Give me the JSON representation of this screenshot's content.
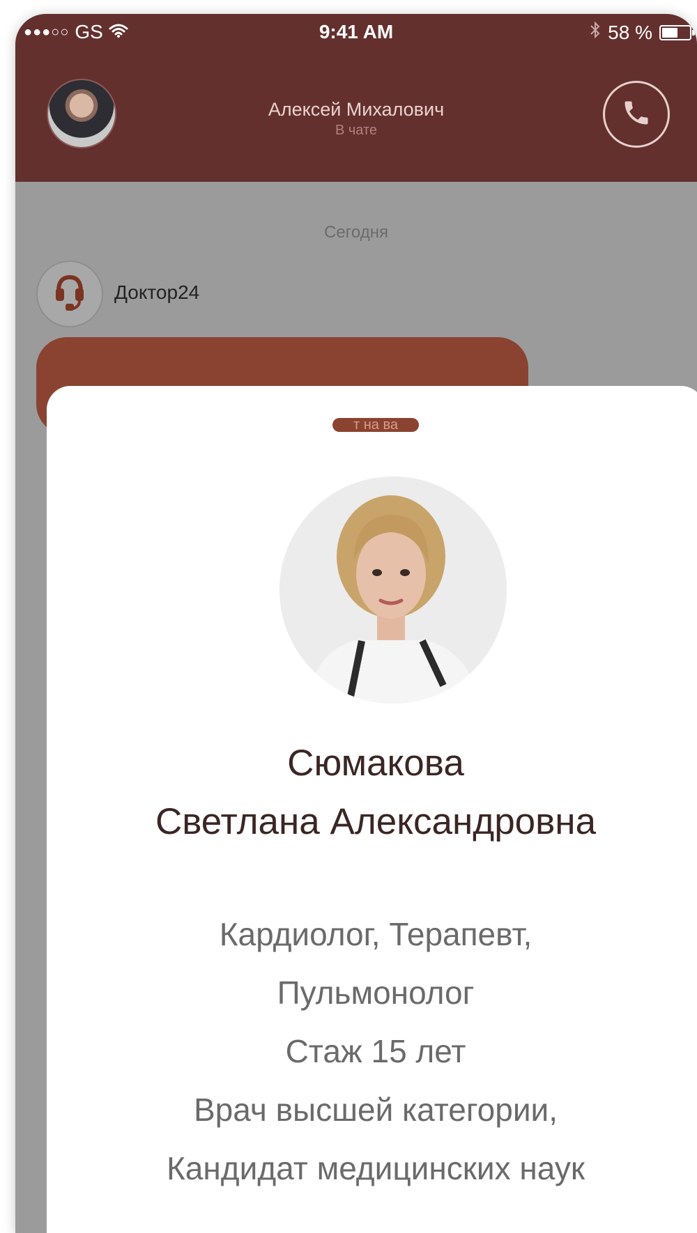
{
  "status_bar": {
    "signal": "●●●○○",
    "carrier": "GS",
    "time": "9:41 AM",
    "battery_text": "58 %",
    "battery_level": 0.58
  },
  "header": {
    "contact_name": "Алексей Михалович",
    "contact_status": "В чате"
  },
  "chat": {
    "date_label": "Сегодня",
    "sender_name": "Доктор24",
    "bubble_partial_text": "т на ва"
  },
  "doctor": {
    "surname": "Сюмакова",
    "given_names": "Светлана Александровна",
    "info_lines": [
      "Кардиолог, Терапевт,",
      "Пульмонолог",
      "Стаж 15 лет",
      "Врач высшей категории,",
      "Кандидат медицинских наук"
    ]
  },
  "colors": {
    "header_bg": "#64302e",
    "accent": "#8a4330",
    "modal_bg": "#ffffff"
  },
  "icons": [
    "wifi-icon",
    "bluetooth-icon",
    "battery-icon",
    "phone-icon",
    "headset-icon"
  ]
}
